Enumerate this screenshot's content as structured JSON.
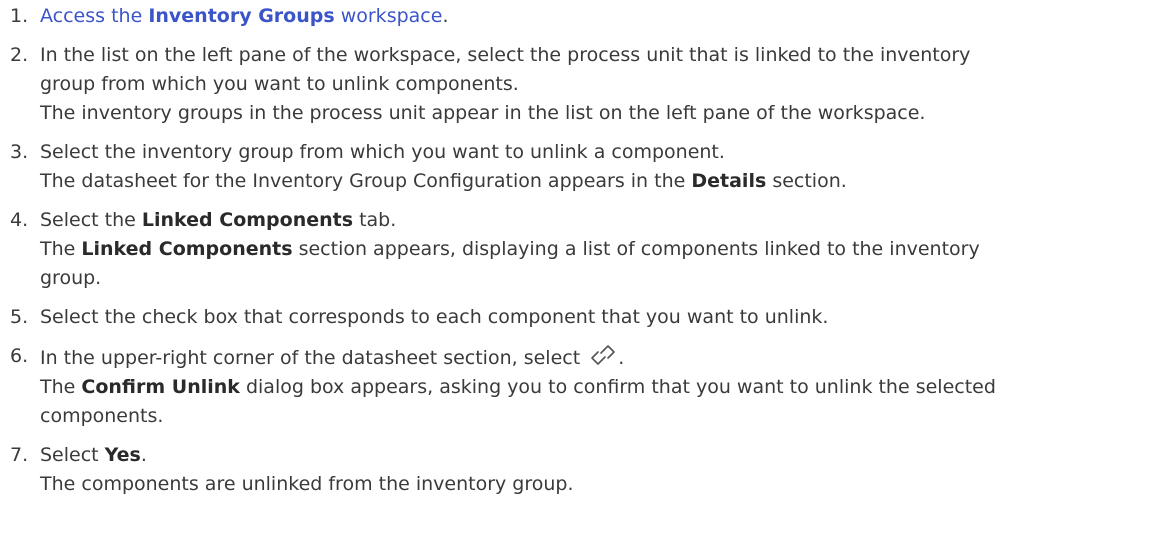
{
  "steps": [
    {
      "num": "1.",
      "link_prefix": "Access the ",
      "link_bold": "Inventory Groups",
      "link_suffix": " workspace",
      "after": "."
    },
    {
      "num": "2.",
      "line1": "In the list on the left pane of the workspace, select the process unit that is linked to the inventory",
      "line2": "group from which you want to unlink components.",
      "line3": "The inventory groups in the process unit appear in the list on the left pane of the workspace."
    },
    {
      "num": "3.",
      "line1": "Select the inventory group from which you want to unlink a component.",
      "line2_prefix": "The datasheet for the Inventory Group Configuration appears in the ",
      "line2_bold": "Details",
      "line2_suffix": " section."
    },
    {
      "num": "4.",
      "line1_prefix": "Select the ",
      "line1_bold": "Linked Components",
      "line1_suffix": " tab.",
      "line2_prefix": "The ",
      "line2_bold": "Linked Components",
      "line2_suffix": " section appears, displaying a list of components linked to the inventory",
      "line3": "group."
    },
    {
      "num": "5.",
      "line1": "Select the check box that corresponds to each component that you want to unlink."
    },
    {
      "num": "6.",
      "line1_prefix": "In the upper-right corner of the datasheet section, select ",
      "line1_suffix": ".",
      "icon": "unlink-icon",
      "line2_prefix": "The ",
      "line2_bold": "Confirm Unlink",
      "line2_suffix": " dialog box appears, asking you to confirm that you want to unlink the selected",
      "line3": "components."
    },
    {
      "num": "7.",
      "line1_prefix": "Select ",
      "line1_bold": "Yes",
      "line1_suffix": ".",
      "line2": "The components are unlinked from the inventory group."
    }
  ],
  "colors": {
    "link": "#3b55c9",
    "text": "#3a3a3a"
  }
}
